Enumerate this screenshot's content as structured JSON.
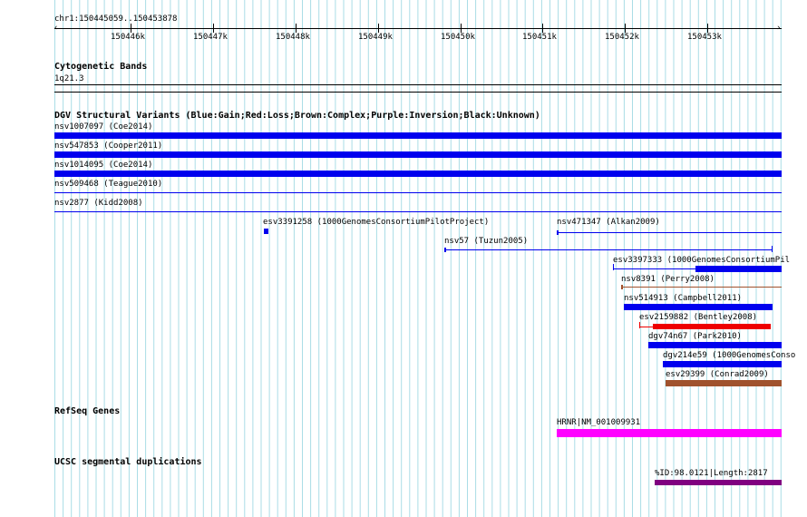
{
  "ruler": {
    "label": "chr1:150445059..150453878",
    "ticks": [
      "150446k",
      "150447k",
      "150448k",
      "150449k",
      "150450k",
      "150451k",
      "150452k",
      "150453k"
    ]
  },
  "cytogenetic": {
    "header": "Cytogenetic Bands",
    "band": "1q21.3"
  },
  "dgv": {
    "header": "DGV Structural Variants (Blue:Gain;Red:Loss;Brown:Complex;Purple:Inversion;Black:Unknown)",
    "features": [
      {
        "label": "nsv1007097 (Coe2014)",
        "color": "#0000ee"
      },
      {
        "label": "nsv547853 (Cooper2011)",
        "color": "#0000ee"
      },
      {
        "label": "nsv1014095 (Coe2014)",
        "color": "#0000ee"
      },
      {
        "label": "nsv509468 (Teague2010)",
        "color": "#0000ee"
      },
      {
        "label": "nsv2877 (Kidd2008)",
        "color": "#0000ee"
      },
      {
        "label": "esv3391258 (1000GenomesConsortiumPilotProject)",
        "color": "#0000ee"
      },
      {
        "label": "nsv471347 (Alkan2009)",
        "color": "#0000ee"
      },
      {
        "label": "nsv57 (Tuzun2005)",
        "color": "#0000ee"
      },
      {
        "label": "esv3397333 (1000GenomesConsortiumPil",
        "color": "#0000ee"
      },
      {
        "label": "nsv8391 (Perry2008)",
        "color": "#a0522d"
      },
      {
        "label": "nsv514913 (Campbell2011)",
        "color": "#0000ee"
      },
      {
        "label": "esv2159882 (Bentley2008)",
        "color": "#ee0000"
      },
      {
        "label": "dgv74n67 (Park2010)",
        "color": "#0000ee"
      },
      {
        "label": "dgv214e59 (1000GenomesConso",
        "color": "#0000ee"
      },
      {
        "label": "esv29399 (Conrad2009)",
        "color": "#a0522d"
      }
    ]
  },
  "refseq": {
    "header": "RefSeq Genes",
    "gene": "HRNR|NM_001009931",
    "color": "#ff00ff"
  },
  "segdup": {
    "header": "UCSC segmental duplications",
    "label": "%ID:98.0121|Length:2817",
    "color": "#800080"
  }
}
